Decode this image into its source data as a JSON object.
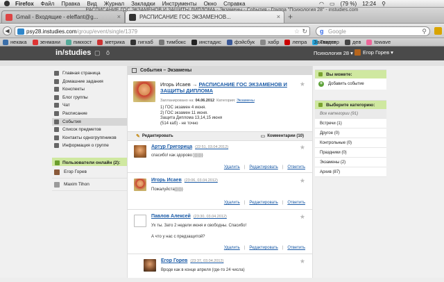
{
  "menubar": {
    "items": [
      "Firefox",
      "Файл",
      "Правка",
      "Вид",
      "Журнал",
      "Закладки",
      "Инструменты",
      "Окно",
      "Справка"
    ],
    "battery": "(79 %)",
    "time": "12:24"
  },
  "window": {
    "title": "РАСПИСАНИЕ ГОС ЭКЗАМЕНОВ И ЗАЩИТЫ ДИПЛОМА - Экзамены - События - Группа \"Психология 28\" - instudies.com"
  },
  "tabs": [
    {
      "label": "Gmail - Входящие - eleffant@g...",
      "close": "×"
    },
    {
      "label": "РАСПИСАНИЕ ГОС ЭКЗАМЕНОВ...",
      "close": "×"
    }
  ],
  "newtab": "+",
  "navbar": {
    "url_host": "psy28.instudies.com",
    "url_path": "/group/event/single/1379",
    "search_placeholder": "Google"
  },
  "bookmarks": {
    "items": [
      "некака",
      "зенмани",
      "пикхост",
      "метрика",
      "гигхаб",
      "тимбокс",
      "инстадис",
      "фэйсбук",
      "хабр",
      "лепра",
      "Твиттер",
      "дев",
      "towave"
    ],
    "right": "Закладки"
  },
  "site": {
    "logo": "in/studies",
    "group_label": "Психология 28 ▾",
    "user_label": "Егор Горев ▾"
  },
  "sidebar": {
    "items": [
      {
        "label": "Главная страница",
        "active": false
      },
      {
        "label": "Домашние задания",
        "active": false
      },
      {
        "label": "Конспекты",
        "active": false
      },
      {
        "label": "Блог группы",
        "active": false
      },
      {
        "label": "Чат",
        "active": false
      },
      {
        "label": "Расписание",
        "active": false
      },
      {
        "label": "События",
        "active": true
      },
      {
        "label": "Список предметов",
        "active": false
      },
      {
        "label": "Контакты одногруппников",
        "active": false
      },
      {
        "label": "Информация о группе",
        "active": false
      }
    ],
    "online_title": "Пользователи онлайн (2):",
    "online_users": [
      "Егор Горев",
      "Maxim Tihon"
    ]
  },
  "main": {
    "heading": "События – Экзамены",
    "post": {
      "author": "Игорь Исаев",
      "arrow": " → ",
      "title": "РАСПИСАНИЕ ГОС ЭКЗАМЕНОВ И ЗАЩИТЫ ДИПЛОМА",
      "planned_label": "Запланировано на:",
      "planned_date": "04.06.2012",
      "category_label": "Категория:",
      "category": "Экзамены",
      "lines": [
        "1) ГОС экзамен 4 июня.",
        "2) ГОС экзамен 11 июня.",
        "Защита Диплома 13,14,15 июня",
        "(514 каб) - не точно"
      ],
      "edit_label": "Редактировать",
      "comments_label": "Комментарии (10)"
    },
    "comments": [
      {
        "name": "Артур Григорица",
        "date": "(22:51, 03.04.2012)",
        "text": [
          "спасибо! как здорово:)))))))"
        ],
        "actions": [
          "Удалить",
          "Редактировать",
          "Ответить"
        ]
      },
      {
        "name": "Игорь Исаев",
        "date": "(23:06, 03.04.2012)",
        "text": [
          "Пожалуйста))))))"
        ],
        "actions": [
          "Удалить",
          "Редактировать",
          "Ответить"
        ]
      },
      {
        "name": "Павлов Алексей",
        "date": "(23:30, 03.04.2012)",
        "text": [
          "Ух ты. Зато 2 недели июня и свободны. Спасибо!",
          "",
          "А что у нас с предзащитой?"
        ],
        "actions": [
          "Удалить",
          "Редактировать",
          "Ответить"
        ]
      },
      {
        "name": "Егор Горев",
        "date": "(23:37, 03.04.2012)",
        "text": [
          "Вроде как в конце апреля (где-то 24 числа)"
        ],
        "actions": []
      }
    ]
  },
  "right": {
    "can_title": "Вы можете:",
    "add_event": "Добавить событие",
    "cat_title": "Выберите категорию:",
    "categories": [
      "Все категории (91)",
      "Встречи (1)",
      "Другое (0)",
      "Контрольные (0)",
      "Праздники (0)",
      "Экзамены (2)",
      "Архив (87)"
    ]
  },
  "colors": {
    "accent_green": "#cfe8a0",
    "link": "#1a5aa6",
    "header": "#4a4a4a"
  }
}
